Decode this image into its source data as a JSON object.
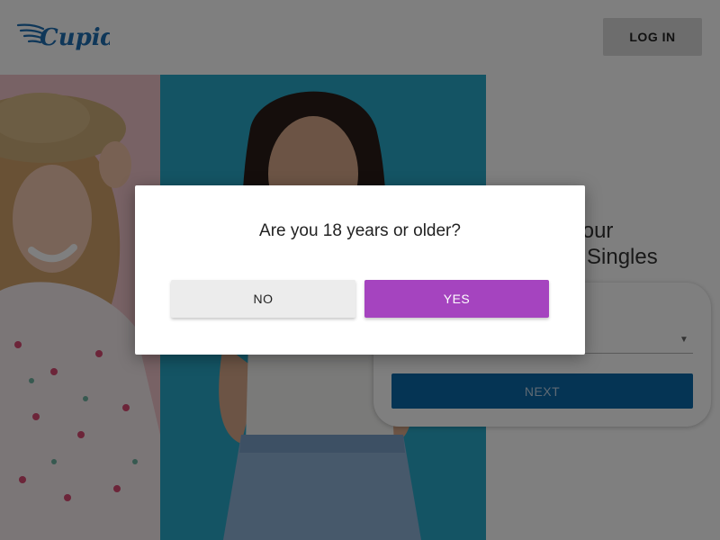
{
  "brand": {
    "logo_text": "Cupid",
    "logo_color": "#1f6fb3"
  },
  "header": {
    "login_label": "LOG IN"
  },
  "hero": {
    "line1": "Site Is Your",
    "line2": "Singles"
  },
  "form": {
    "next_label": "NEXT",
    "next_color": "#0a68a8"
  },
  "dialog": {
    "question": "Are you 18 years or older?",
    "no_label": "NO",
    "yes_label": "YES",
    "yes_color": "#a544bf"
  },
  "icons": {
    "logo": "cupid-wing-logo",
    "caret": "chevron-down-icon"
  }
}
